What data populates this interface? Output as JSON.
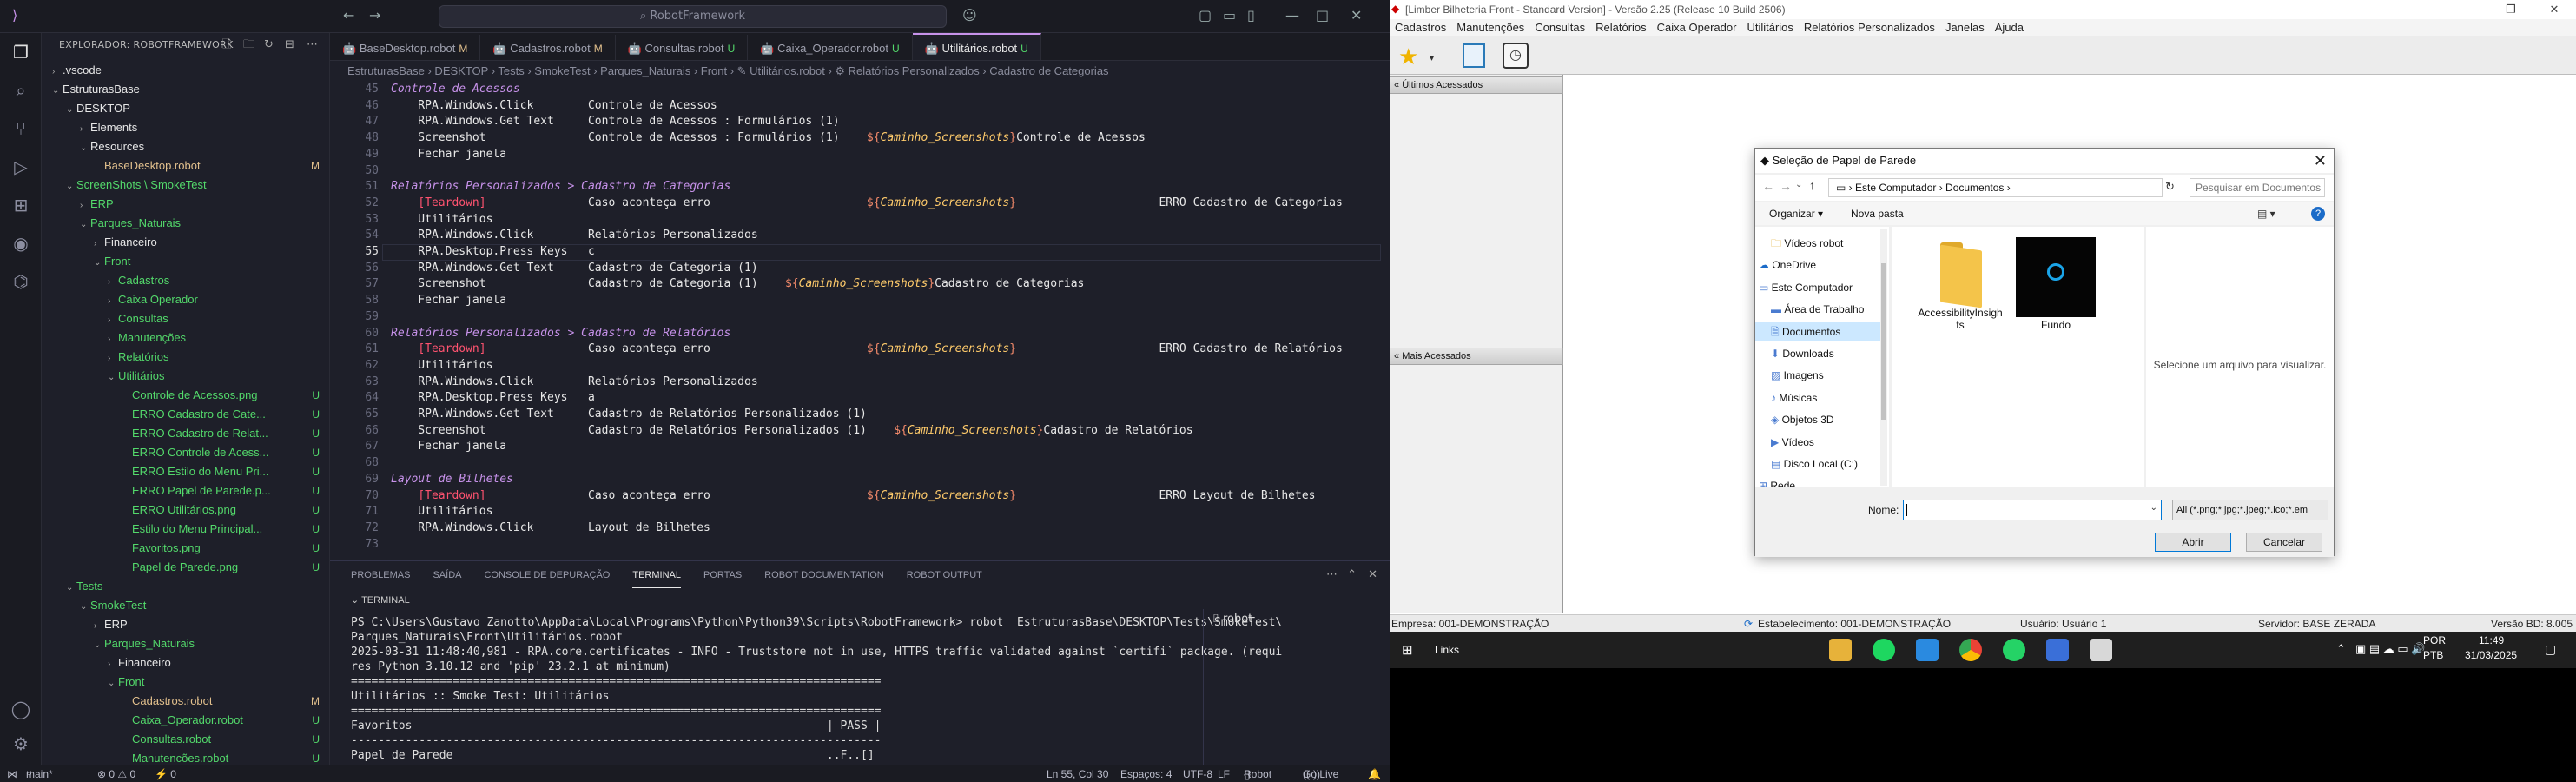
{
  "vscode": {
    "title_search": "RobotFramework",
    "explorer_title": "EXPLORADOR: ROBOTFRAMEWORK",
    "tree": [
      {
        "label": ".vscode",
        "color": "c-f",
        "indent": 0,
        "twisty": "›",
        "status": ""
      },
      {
        "label": "EstruturasBase",
        "color": "c-f",
        "indent": 0,
        "twisty": "⌄",
        "status": ""
      },
      {
        "label": "DESKTOP",
        "color": "c-f",
        "indent": 1,
        "twisty": "⌄",
        "status": ""
      },
      {
        "label": "Elements",
        "color": "c-f",
        "indent": 2,
        "twisty": "›",
        "status": ""
      },
      {
        "label": "Resources",
        "color": "c-f",
        "indent": 2,
        "twisty": "⌄",
        "status": ""
      },
      {
        "label": "BaseDesktop.robot",
        "color": "c-m",
        "indent": 3,
        "twisty": "",
        "status": "M"
      },
      {
        "label": "ScreenShots \\ SmokeTest",
        "color": "c-g",
        "indent": 1,
        "twisty": "⌄",
        "status": ""
      },
      {
        "label": "ERP",
        "color": "c-g",
        "indent": 2,
        "twisty": "›",
        "status": ""
      },
      {
        "label": "Parques_Naturais",
        "color": "c-g",
        "indent": 2,
        "twisty": "⌄",
        "status": ""
      },
      {
        "label": "Financeiro",
        "color": "c-f",
        "indent": 3,
        "twisty": "›",
        "status": ""
      },
      {
        "label": "Front",
        "color": "c-g",
        "indent": 3,
        "twisty": "⌄",
        "status": ""
      },
      {
        "label": "Cadastros",
        "color": "c-g",
        "indent": 4,
        "twisty": "›",
        "status": ""
      },
      {
        "label": "Caixa Operador",
        "color": "c-g",
        "indent": 4,
        "twisty": "›",
        "status": ""
      },
      {
        "label": "Consultas",
        "color": "c-g",
        "indent": 4,
        "twisty": "›",
        "status": ""
      },
      {
        "label": "Manutenções",
        "color": "c-g",
        "indent": 4,
        "twisty": "›",
        "status": ""
      },
      {
        "label": "Relatórios",
        "color": "c-g",
        "indent": 4,
        "twisty": "›",
        "status": ""
      },
      {
        "label": "Utilitários",
        "color": "c-g",
        "indent": 4,
        "twisty": "⌄",
        "status": ""
      },
      {
        "label": "Controle de Acessos.png",
        "color": "c-g",
        "indent": 5,
        "twisty": "",
        "status": "U"
      },
      {
        "label": "ERRO Cadastro de Cate...",
        "color": "c-g",
        "indent": 5,
        "twisty": "",
        "status": "U"
      },
      {
        "label": "ERRO Cadastro de Relat...",
        "color": "c-g",
        "indent": 5,
        "twisty": "",
        "status": "U"
      },
      {
        "label": "ERRO Controle de Acess...",
        "color": "c-g",
        "indent": 5,
        "twisty": "",
        "status": "U"
      },
      {
        "label": "ERRO Estilo do Menu Pri...",
        "color": "c-g",
        "indent": 5,
        "twisty": "",
        "status": "U"
      },
      {
        "label": "ERRO Papel de Parede.p...",
        "color": "c-g",
        "indent": 5,
        "twisty": "",
        "status": "U"
      },
      {
        "label": "ERRO Utilitários.png",
        "color": "c-g",
        "indent": 5,
        "twisty": "",
        "status": "U"
      },
      {
        "label": "Estilo do Menu Principal...",
        "color": "c-g",
        "indent": 5,
        "twisty": "",
        "status": "U"
      },
      {
        "label": "Favoritos.png",
        "color": "c-g",
        "indent": 5,
        "twisty": "",
        "status": "U"
      },
      {
        "label": "Papel de Parede.png",
        "color": "c-g",
        "indent": 5,
        "twisty": "",
        "status": "U"
      },
      {
        "label": "Tests",
        "color": "c-g",
        "indent": 1,
        "twisty": "⌄",
        "status": ""
      },
      {
        "label": "SmokeTest",
        "color": "c-g",
        "indent": 2,
        "twisty": "⌄",
        "status": ""
      },
      {
        "label": "ERP",
        "color": "c-f",
        "indent": 3,
        "twisty": "›",
        "status": ""
      },
      {
        "label": "Parques_Naturais",
        "color": "c-g",
        "indent": 3,
        "twisty": "⌄",
        "status": ""
      },
      {
        "label": "Financeiro",
        "color": "c-f",
        "indent": 4,
        "twisty": "›",
        "status": ""
      },
      {
        "label": "Front",
        "color": "c-g",
        "indent": 4,
        "twisty": "⌄",
        "status": ""
      },
      {
        "label": "Cadastros.robot",
        "color": "c-m",
        "indent": 5,
        "twisty": "",
        "status": "M"
      },
      {
        "label": "Caixa_Operador.robot",
        "color": "c-g",
        "indent": 5,
        "twisty": "",
        "status": "U"
      },
      {
        "label": "Consultas.robot",
        "color": "c-g",
        "indent": 5,
        "twisty": "",
        "status": "U"
      },
      {
        "label": "Manutencões.robot",
        "color": "c-g",
        "indent": 5,
        "twisty": "",
        "status": "U"
      }
    ],
    "tabs": [
      {
        "label": "BaseDesktop.robot",
        "badge": "M",
        "active": false
      },
      {
        "label": "Cadastros.robot",
        "badge": "M",
        "active": false
      },
      {
        "label": "Consultas.robot",
        "badge": "U",
        "active": false
      },
      {
        "label": "Caixa_Operador.robot",
        "badge": "U",
        "active": false
      },
      {
        "label": "Utilitários.robot",
        "badge": "U",
        "active": true
      }
    ],
    "breadcrumb": "EstruturasBase › DESKTOP › Tests › SmokeTest › Parques_Naturais › Front › ✎ Utilitários.robot › ⚙ Relatórios Personalizados › Cadastro de Categorias",
    "editor": {
      "current_line": "55",
      "lines": [
        {
          "n": "45",
          "html": "<span class=\"cm\">Controle de Acessos</span>"
        },
        {
          "n": "46",
          "html": "    RPA.Windows.Click        Controle de Acessos"
        },
        {
          "n": "47",
          "html": "    RPA.Windows.Get Text     Controle de Acessos : Formulários (1)"
        },
        {
          "n": "48",
          "html": "    Screenshot               Controle de Acessos : Formulários (1)    <span class=\"v\">${</span><span class=\"vt\">Caminho_Screenshots</span><span class=\"v\">}</span>Controle de Acessos"
        },
        {
          "n": "49",
          "html": "    Fechar janela"
        },
        {
          "n": "50",
          "html": ""
        },
        {
          "n": "51",
          "html": "<span class=\"cm\">Relatórios Personalizados &gt; Cadastro de Categorias</span>"
        },
        {
          "n": "52",
          "html": "    <span class=\"tag\">[Teardown]</span>               Caso aconteça erro                       <span class=\"v\">${</span><span class=\"vt\">Caminho_Screenshots</span><span class=\"v\">}</span>                     ERRO Cadastro de Categorias"
        },
        {
          "n": "53",
          "html": "    Utilitários"
        },
        {
          "n": "54",
          "html": "    RPA.Windows.Click        Relatórios Personalizados"
        },
        {
          "n": "55",
          "html": "    RPA.Desktop.Press Keys   c"
        },
        {
          "n": "56",
          "html": "    RPA.Windows.Get Text     Cadastro de Categoria (1)"
        },
        {
          "n": "57",
          "html": "    Screenshot               Cadastro de Categoria (1)    <span class=\"v\">${</span><span class=\"vt\">Caminho_Screenshots</span><span class=\"v\">}</span>Cadastro de Categorias"
        },
        {
          "n": "58",
          "html": "    Fechar janela"
        },
        {
          "n": "59",
          "html": ""
        },
        {
          "n": "60",
          "html": "<span class=\"cm\">Relatórios Personalizados &gt; Cadastro de Relatórios</span>"
        },
        {
          "n": "61",
          "html": "    <span class=\"tag\">[Teardown]</span>               Caso aconteça erro                       <span class=\"v\">${</span><span class=\"vt\">Caminho_Screenshots</span><span class=\"v\">}</span>                     ERRO Cadastro de Relatórios"
        },
        {
          "n": "62",
          "html": "    Utilitários"
        },
        {
          "n": "63",
          "html": "    RPA.Windows.Click        Relatórios Personalizados"
        },
        {
          "n": "64",
          "html": "    RPA.Desktop.Press Keys   a"
        },
        {
          "n": "65",
          "html": "    RPA.Windows.Get Text     Cadastro de Relatórios Personalizados (1)"
        },
        {
          "n": "66",
          "html": "    Screenshot               Cadastro de Relatórios Personalizados (1)    <span class=\"v\">${</span><span class=\"vt\">Caminho_Screenshots</span><span class=\"v\">}</span>Cadastro de Relatórios"
        },
        {
          "n": "67",
          "html": "    Fechar janela"
        },
        {
          "n": "68",
          "html": ""
        },
        {
          "n": "69",
          "html": "<span class=\"cm\">Layout de Bilhetes</span>"
        },
        {
          "n": "70",
          "html": "    <span class=\"tag\">[Teardown]</span>               Caso aconteça erro                       <span class=\"v\">${</span><span class=\"vt\">Caminho_Screenshots</span><span class=\"v\">}</span>                     ERRO Layout de Bilhetes"
        },
        {
          "n": "71",
          "html": "    Utilitários"
        },
        {
          "n": "72",
          "html": "    RPA.Windows.Click        Layout de Bilhetes"
        },
        {
          "n": "73",
          "html": ""
        }
      ]
    },
    "panel_tabs": [
      "PROBLEMAS",
      "SAÍDA",
      "CONSOLE DE DEPURAÇÃO",
      "TERMINAL",
      "PORTAS",
      "ROBOT DOCUMENTATION",
      "ROBOT OUTPUT"
    ],
    "panel_active": "TERMINAL",
    "terminal_header": "TERMINAL",
    "terminal_lines": [
      "PS C:\\Users\\Gustavo Zanotto\\AppData\\Local\\Programs\\Python\\Python39\\Scripts\\RobotFramework> robot  EstruturasBase\\DESKTOP\\Tests\\SmokeTest\\",
      "Parques_Naturais\\Front\\Utilitários.robot",
      "2025-03-31 11:48:40,981 - RPA.core.certificates - INFO - Truststore not in use, HTTPS traffic validated against `certifi` package. (requi",
      "res Python 3.10.12 and 'pip' 23.2.1 at minimum)",
      "==============================================================================",
      "Utilitários :: Smoke Test: Utilitários",
      "==============================================================================",
      "Favoritos                                                             | PASS |",
      "------------------------------------------------------------------------------",
      "Papel de Parede                                                       ..F..[]"
    ],
    "terminal_instance": "robot",
    "status": {
      "branch": "main*",
      "problems": "⊗ 0 ⚠ 0",
      "ports": "⚡ 0",
      "position": "Ln 55, Col 30",
      "spaces": "Espaços: 4",
      "encoding": "UTF-8",
      "eol": "LF",
      "language": "Robot",
      "golive": "Go Live"
    }
  },
  "limber": {
    "window_title": "[Limber Bilheteria Front - Standard Version] - Versão 2.25 (Release 10 Build 2506)",
    "menu": [
      "Cadastros",
      "Manutenções",
      "Consultas",
      "Relatórios",
      "Caixa Operador",
      "Utilitários",
      "Relatórios Personalizados",
      "Janelas",
      "Ajuda"
    ],
    "left_panel_1": "Últimos Acessados",
    "left_panel_2": "Mais Acessados",
    "status": {
      "empresa": "Empresa: 001-DEMONSTRAÇÃO",
      "estabelecimento": "Estabelecimento: 001-DEMONSTRAÇÃO",
      "usuario": "Usuário: Usuário 1",
      "servidor": "Servidor: BASE ZERADA",
      "versao": "Versão BD: 8.005"
    }
  },
  "dialog": {
    "title": "Seleção de Papel de Parede",
    "address": "› Este Computador › Documentos ›",
    "search_placeholder": "Pesquisar em Documentos",
    "organize": "Organizar ▾",
    "new_folder": "Nova pasta",
    "nav": [
      {
        "label": "Vídeos robot",
        "indent": 18,
        "selected": false
      },
      {
        "label": "OneDrive",
        "indent": 4,
        "selected": false
      },
      {
        "label": "Este Computador",
        "indent": 4,
        "selected": false
      },
      {
        "label": "Área de Trabalho",
        "indent": 18,
        "selected": false
      },
      {
        "label": "Documentos",
        "indent": 18,
        "selected": true
      },
      {
        "label": "Downloads",
        "indent": 18,
        "selected": false
      },
      {
        "label": "Imagens",
        "indent": 18,
        "selected": false
      },
      {
        "label": "Músicas",
        "indent": 18,
        "selected": false
      },
      {
        "label": "Objetos 3D",
        "indent": 18,
        "selected": false
      },
      {
        "label": "Vídeos",
        "indent": 18,
        "selected": false
      },
      {
        "label": "Disco Local (C:)",
        "indent": 18,
        "selected": false
      },
      {
        "label": "Rede",
        "indent": 4,
        "selected": false
      }
    ],
    "files": [
      {
        "label": "AccessibilityInsights",
        "kind": "folder"
      },
      {
        "label": "Fundo",
        "kind": "image"
      }
    ],
    "preview_text": "Selecione um arquivo para visualizar.",
    "name_label": "Nome:",
    "name_value": "",
    "filetype": "All (*.png;*.jpg;*.jpeg;*.ico;*.em",
    "open_button": "Abrir",
    "cancel_button": "Cancelar"
  },
  "taskbar": {
    "links": "Links",
    "lang": "POR",
    "layout": "PTB",
    "time": "11:49",
    "date": "31/03/2025"
  }
}
